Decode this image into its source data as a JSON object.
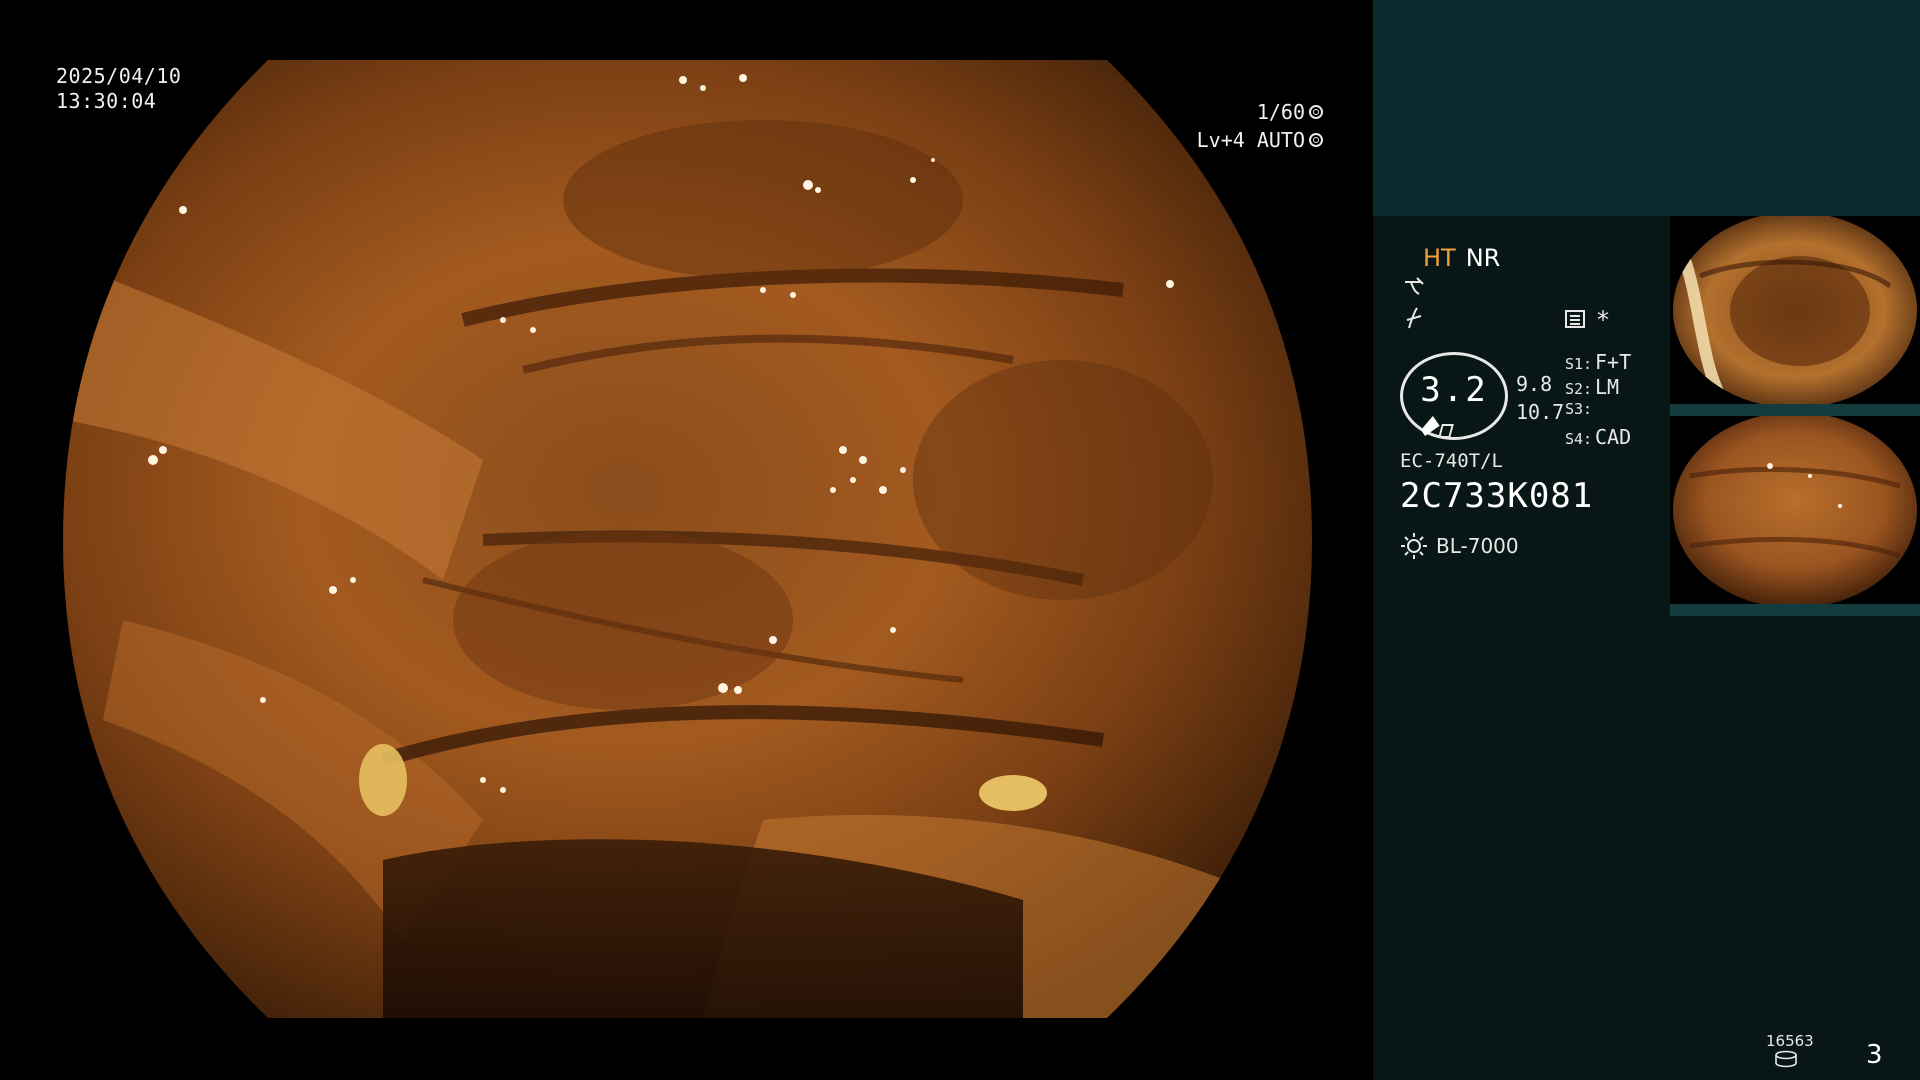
{
  "overlay": {
    "date": "2025/04/10",
    "time": "13:30:04",
    "shutter": "1/60",
    "level": "Lv+4 AUTO"
  },
  "panel": {
    "ht_label": "HT",
    "nr_label": "NR",
    "enhance_glyph": "𝓍",
    "function_glyph": "≁",
    "asterisk": "*",
    "zoom_value": "3.2",
    "zoom_side_top": "9.8",
    "zoom_side_bottom": "10.7",
    "switches": [
      {
        "key": "S1:",
        "value": "F+T"
      },
      {
        "key": "S2:",
        "value": "LM"
      },
      {
        "key": "S3:",
        "value": ""
      },
      {
        "key": "S4:",
        "value": "CAD"
      }
    ],
    "scope_model": "EC-740T/L",
    "scope_serial": "2C733K081",
    "light_source": "BL-7000",
    "image_counter": "16563",
    "page_number": "3"
  },
  "colors": {
    "panel_top": "#0a2b2e",
    "panel_body": "#091616",
    "ht_accent": "#f0a040",
    "thumb_strip": "#143c3e"
  },
  "icons": {
    "shutter_mode": "ring-icon",
    "auto_mode": "ring-icon",
    "menu": "menu-icon",
    "light": "sun-icon",
    "storage": "disk-icon"
  }
}
